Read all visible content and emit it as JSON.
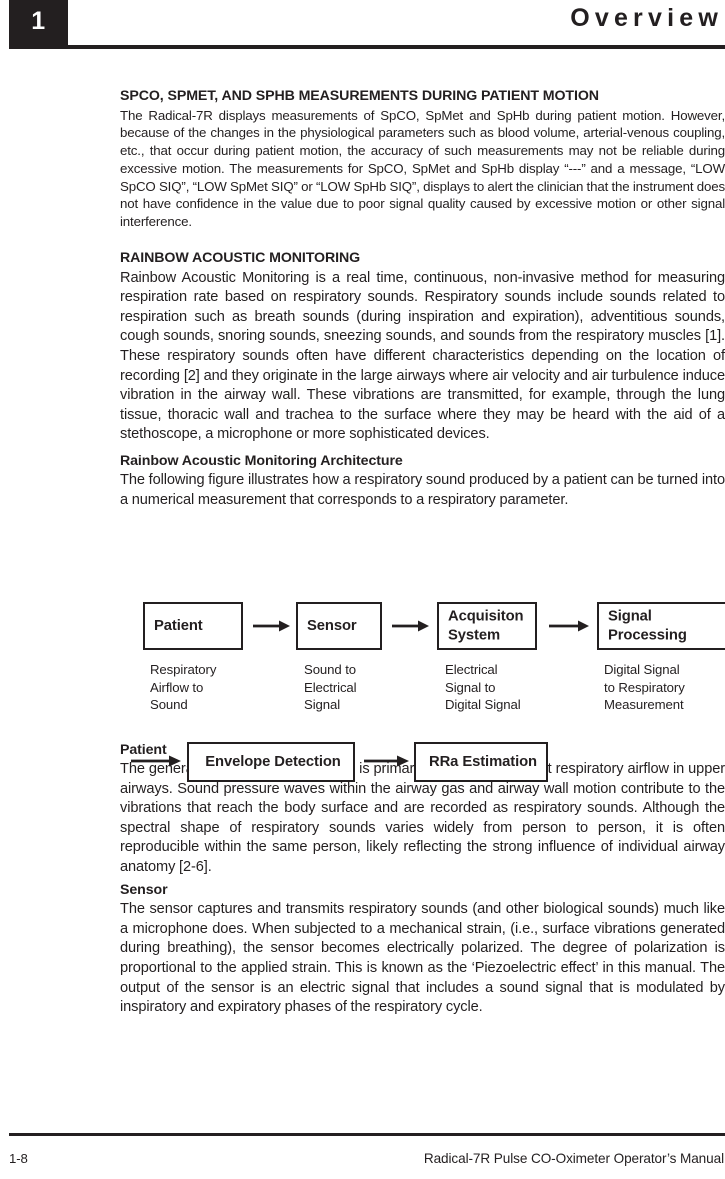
{
  "header": {
    "chapter_number": "1",
    "title": "Overview"
  },
  "sections": {
    "motion_heading": "SPCO, SPMET, AND SPHB MEASUREMENTS DURING PATIENT MOTION",
    "motion_body": "The Radical-7R displays measurements of SpCO, SpMet and SpHb during patient motion. However, because of the changes in the physiological parameters such as blood volume, arterial-venous coupling, etc., that occur during patient motion, the accuracy of such measurements may not be reliable during excessive motion. The measurements for SpCO, SpMet and SpHb display “---” and a message, “LOW SpCO SIQ”, “LOW SpMet SIQ” or “LOW SpHb SIQ”, displays to alert the clinician that the instrument does not have confidence in the value due to poor signal quality caused by excessive motion or other signal interference.",
    "ram_heading": "RAINBOW ACOUSTIC MONITORING",
    "ram_body": "Rainbow Acoustic Monitoring is a real time, continuous, non-invasive method for measuring respiration rate based on respiratory sounds. Respiratory sounds include sounds related to respiration such as breath sounds (during inspiration and expiration), adventitious sounds, cough sounds, snoring sounds, sneezing sounds, and sounds from the respiratory muscles [1]. These respiratory sounds often have different characteristics depending on the location of recording [2] and they originate in the large airways where air velocity and air turbulence induce vibration in the airway wall. These vibrations are transmitted, for example, through the lung tissue, thoracic wall and trachea to the surface where they may be heard with the aid of a stethoscope, a microphone or more sophisticated devices.",
    "architecture_heading": "Rainbow Acoustic Monitoring Architecture",
    "architecture_body": "The following figure illustrates how a respiratory sound produced by a patient can be turned into a numerical measurement that corresponds to a respiratory parameter.",
    "patient_heading": "Patient",
    "patient_body": "The generation of respiratory sounds is primarily related to turbulent respiratory airflow in upper airways. Sound pressure waves within the airway gas and airway wall motion contribute to the vibrations that reach the body surface and are recorded as respiratory sounds. Although the spectral shape of respiratory sounds varies widely from person to person, it is often reproducible within the same person, likely reflecting the strong influence of individual airway anatomy [2-6].",
    "sensor_heading": "Sensor",
    "sensor_body": "The sensor captures and transmits respiratory sounds (and other biological sounds) much like a microphone does. When subjected to a mechanical strain, (i.e., surface vibrations generated during breathing), the sensor becomes electrically polarized. The degree of polarization is proportional to the applied strain. This is known as the ‘Piezoelectric effect’ in this manual. The output of the sensor is an electric signal that includes a sound signal that is modulated by inspiratory and expiratory phases of the respiratory cycle."
  },
  "diagram": {
    "boxes": [
      {
        "label": "Patient",
        "caption": "Respiratory\nAirflow to\nSound"
      },
      {
        "label": "Sensor",
        "caption": "Sound to\nElectrical\nSignal"
      },
      {
        "label": "Acquisiton\nSystem",
        "caption": "Electrical\nSignal to\nDigital Signal"
      },
      {
        "label": "Signal\nProcessing",
        "caption": "Digital Signal\nto Respiratory\nMeasurement"
      },
      {
        "label": "Envelope Detection",
        "caption": ""
      },
      {
        "label": "RRa Estimation",
        "caption": ""
      }
    ]
  },
  "footer": {
    "page_number": "1-8",
    "manual_title": "Radical-7R Pulse CO-Oximeter Operator’s Manual"
  }
}
